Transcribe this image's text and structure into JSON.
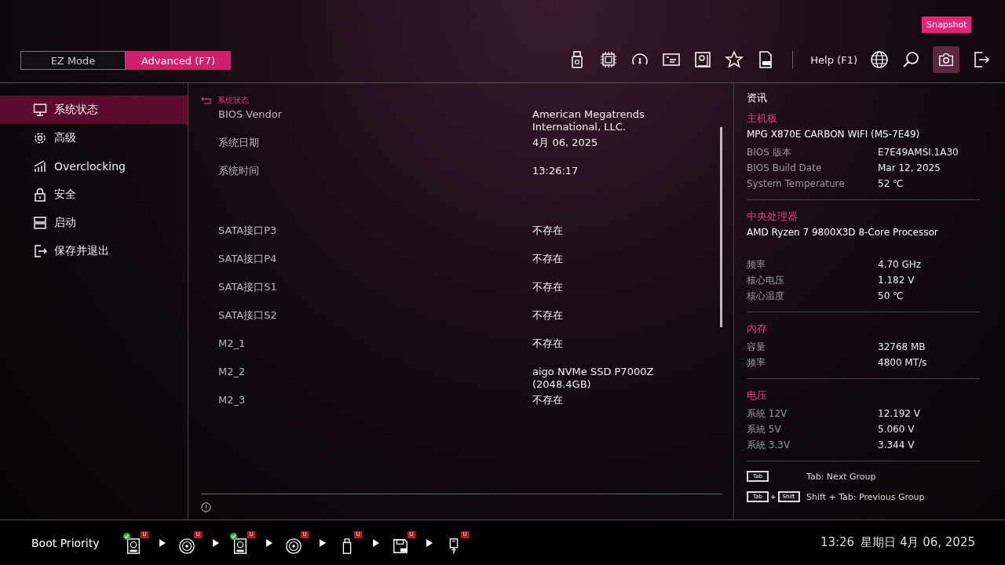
{
  "header": {
    "modes": [
      {
        "label": "EZ Mode",
        "selected": false
      },
      {
        "label": "Advanced (F7)",
        "selected": true
      }
    ],
    "help": "Help (F1)",
    "tooltip": "Snapshot"
  },
  "sidebar": {
    "items": [
      {
        "label": "系统状态",
        "selected": true
      },
      {
        "label": "高级",
        "selected": false
      },
      {
        "label": "Overclocking",
        "selected": false
      },
      {
        "label": "安全",
        "selected": false
      },
      {
        "label": "启动",
        "selected": false
      },
      {
        "label": "保存并退出",
        "selected": false
      }
    ]
  },
  "main": {
    "breadcrumb": "系统状态",
    "rows": [
      {
        "kind": "item",
        "label": "BIOS Vendor",
        "value": "American Megatrends International, LLC."
      },
      {
        "kind": "item",
        "label": "系统日期",
        "value": "4月 06, 2025"
      },
      {
        "kind": "item",
        "label": "系统时间",
        "value": "13:26:17"
      },
      {
        "kind": "gap"
      },
      {
        "kind": "item",
        "label": "SATA接口P3",
        "value": "不存在"
      },
      {
        "kind": "item",
        "label": "SATA接口P4",
        "value": "不存在"
      },
      {
        "kind": "item",
        "label": "SATA接口S1",
        "value": "不存在"
      },
      {
        "kind": "item",
        "label": "SATA接口S2",
        "value": "不存在"
      },
      {
        "kind": "item",
        "label": "M2_1",
        "value": "不存在"
      },
      {
        "kind": "item",
        "label": "M2_2",
        "value": "aigo NVMe SSD P7000Z (2048.4GB)"
      },
      {
        "kind": "item",
        "label": "M2_3",
        "value": "不存在"
      }
    ]
  },
  "info": {
    "title": "资讯",
    "sections": [
      {
        "heading": "主机板",
        "subtitle": "MPG X870E CARBON WIFI (MS-7E49)",
        "rows": [
          {
            "label": "BIOS 版本",
            "value": "E7E49AMSI.1A30"
          },
          {
            "label": "BIOS Build Date",
            "value": "Mar 12, 2025"
          },
          {
            "label": "System Temperature",
            "value": "52 ℃"
          }
        ]
      },
      {
        "heading": "中央处理器",
        "subtitle": "AMD Ryzen 7 9800X3D 8-Core Processor",
        "rows": [
          {
            "label": "频率",
            "value": "4.70 GHz"
          },
          {
            "label": "核心电压",
            "value": "1.182 V"
          },
          {
            "label": "核心温度",
            "value": "50 ℃"
          }
        ]
      },
      {
        "heading": "內存",
        "rows": [
          {
            "label": "容量",
            "value": "32768 MB"
          },
          {
            "label": "频率",
            "value": "4800 MT/s"
          }
        ]
      },
      {
        "heading": "电压",
        "rows": [
          {
            "label": "系統 12V",
            "value": "12.192 V"
          },
          {
            "label": "系統 5V",
            "value": "5.060 V"
          },
          {
            "label": "系統 3.3V",
            "value": "3.344 V"
          }
        ]
      }
    ],
    "hints": [
      {
        "keys": [
          "Tab"
        ],
        "text": "Tab: Next Group"
      },
      {
        "keys": [
          "Tab",
          "Shift"
        ],
        "joiner": "+",
        "text": "Shift + Tab: Previous Group"
      }
    ]
  },
  "footer": {
    "boot_label": "Boot Priority",
    "devices": [
      {
        "kind": "hdd",
        "checked": true,
        "badge": "U"
      },
      {
        "kind": "disc",
        "checked": false,
        "badge": "U"
      },
      {
        "kind": "hdd",
        "checked": true,
        "badge": "U"
      },
      {
        "kind": "disc",
        "checked": false,
        "badge": "U"
      },
      {
        "kind": "usb",
        "checked": false,
        "badge": "U"
      },
      {
        "kind": "floppy",
        "checked": false,
        "badge": "U"
      },
      {
        "kind": "plug",
        "checked": false,
        "badge": "U"
      }
    ],
    "time": "13:26",
    "date": "星期日 4月 06, 2025"
  }
}
